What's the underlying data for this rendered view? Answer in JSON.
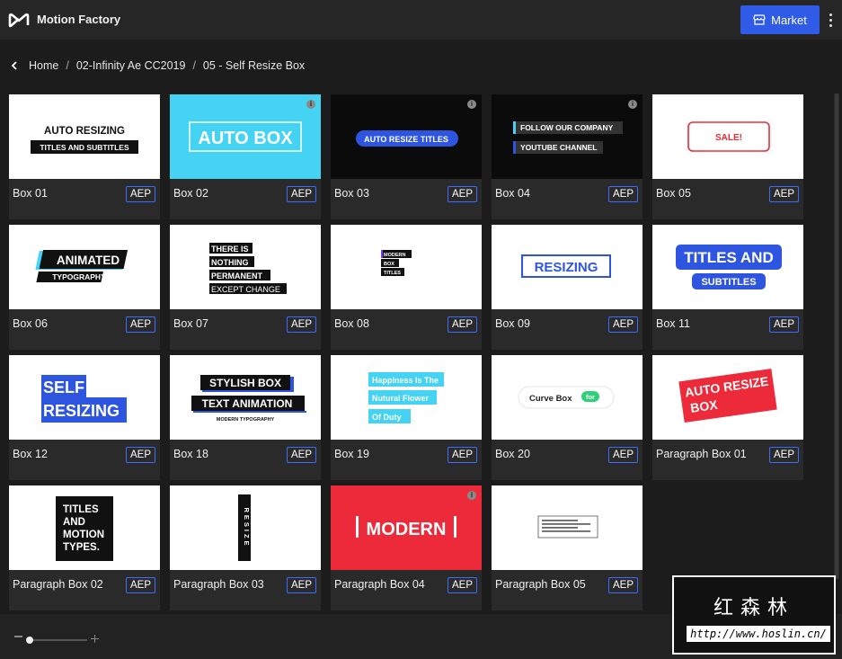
{
  "app": {
    "title": "Motion Factory"
  },
  "header": {
    "market_label": "Market"
  },
  "breadcrumb": {
    "items": [
      "Home",
      "02-Infinity Ae CC2019",
      "05 - Self Resize Box"
    ]
  },
  "cards": [
    {
      "label": "Box 01",
      "badge": "AEP",
      "theme": "white",
      "thumb": [
        "AUTO RESIZING",
        "TITLES AND SUBTITLES"
      ]
    },
    {
      "label": "Box 02",
      "badge": "AEP",
      "theme": "cyan",
      "info": true,
      "thumb": [
        "AUTO BOX"
      ]
    },
    {
      "label": "Box 03",
      "badge": "AEP",
      "theme": "black",
      "info": true,
      "thumb": [
        "AUTO RESIZE TITLES"
      ]
    },
    {
      "label": "Box 04",
      "badge": "AEP",
      "theme": "black",
      "info": true,
      "thumb": [
        "FOLLOW OUR COMPANY",
        "YOUTUBE CHANNEL"
      ]
    },
    {
      "label": "Box 05",
      "badge": "AEP",
      "theme": "white",
      "thumb": [
        "SALE!"
      ]
    },
    {
      "label": "Box 06",
      "badge": "AEP",
      "theme": "white",
      "thumb": [
        "ANIMATED",
        "TYPOGRAPHY"
      ]
    },
    {
      "label": "Box 07",
      "badge": "AEP",
      "theme": "white",
      "thumb": [
        "THERE IS",
        "NOTHING",
        "PERMANENT",
        "EXCEPT CHANGE"
      ]
    },
    {
      "label": "Box 08",
      "badge": "AEP",
      "theme": "white",
      "thumb": [
        "MODERN",
        "BOX",
        "TITLES"
      ]
    },
    {
      "label": "Box 09",
      "badge": "AEP",
      "theme": "white",
      "thumb": [
        "RESIZING"
      ]
    },
    {
      "label": "Box 11",
      "badge": "AEP",
      "theme": "white",
      "thumb": [
        "TITLES AND",
        "SUBTITLES"
      ]
    },
    {
      "label": "Box 12",
      "badge": "AEP",
      "theme": "white",
      "thumb": [
        "SELF",
        "RESIZING"
      ]
    },
    {
      "label": "Box 18",
      "badge": "AEP",
      "theme": "white",
      "thumb": [
        "STYLISH BOX",
        "TEXT ANIMATION",
        "MODERN TYPOGRAPHY"
      ]
    },
    {
      "label": "Box 19",
      "badge": "AEP",
      "theme": "white",
      "thumb": [
        "Happiness Is The",
        "Nutural Flower",
        "Of Duty"
      ]
    },
    {
      "label": "Box 20",
      "badge": "AEP",
      "theme": "white",
      "thumb": [
        "Curve Box",
        "for"
      ]
    },
    {
      "label": "Paragraph Box 01",
      "badge": "AEP",
      "theme": "white",
      "thumb": [
        "AUTO RESIZE",
        "BOX"
      ]
    },
    {
      "label": "Paragraph Box 02",
      "badge": "AEP",
      "theme": "white",
      "thumb": [
        "TITLES",
        "AND",
        "MOTION",
        "TYPES."
      ]
    },
    {
      "label": "Paragraph Box 03",
      "badge": "AEP",
      "theme": "white",
      "thumb": [
        "RESIZE"
      ]
    },
    {
      "label": "Paragraph Box 04",
      "badge": "AEP",
      "theme": "red",
      "info": true,
      "thumb": [
        "MODERN"
      ]
    },
    {
      "label": "Paragraph Box 05",
      "badge": "AEP",
      "theme": "white",
      "thumb": []
    }
  ],
  "watermark": {
    "text": "红森林",
    "url": "http://www.hoslin.cn/"
  },
  "colors": {
    "accent": "#2f5be6",
    "badge_border": "#3b6cff",
    "red": "#ec2a39",
    "blue": "#2e55e0",
    "cyan": "#45d3f3",
    "green": "#2fd07a"
  }
}
